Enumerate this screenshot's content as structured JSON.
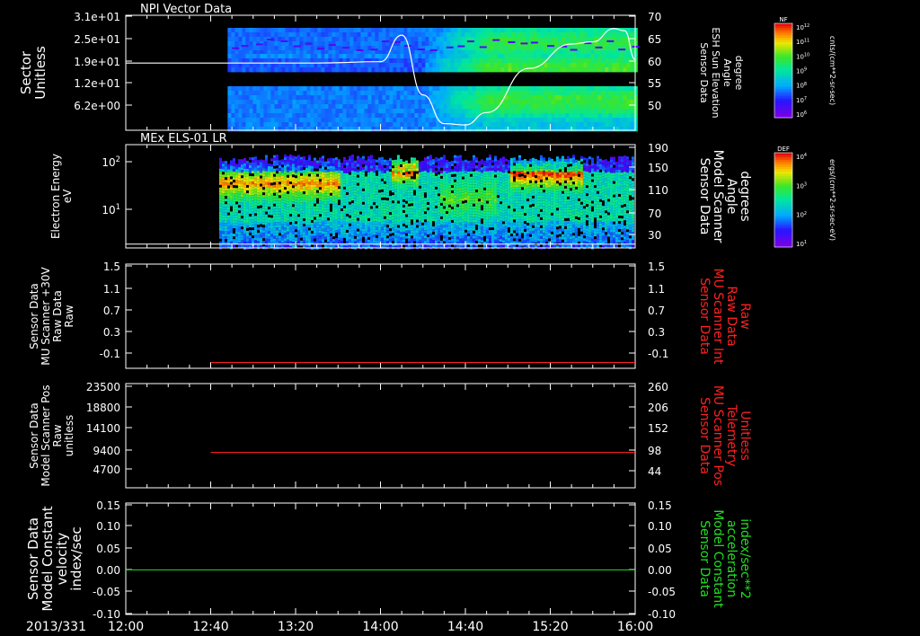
{
  "time_axis": {
    "date_label": "2013/331",
    "ticks": [
      "12:00",
      "12:40",
      "13:20",
      "14:00",
      "14:40",
      "15:20",
      "16:00"
    ]
  },
  "colorbars": [
    {
      "tag": "NF",
      "unit": "cnts/(cm**2-sr-sec)",
      "ticks": [
        "10^12",
        "10^11",
        "10^10",
        "10^9",
        "10^8",
        "10^7",
        "10^6"
      ]
    },
    {
      "tag": "DEF",
      "unit": "ergs/(cm**2-sr-sec-eV)",
      "ticks": [
        "10^4",
        "10^3",
        "10^2",
        "10^1"
      ]
    }
  ],
  "panels": [
    {
      "id": "npi",
      "title": "NPI Vector Data",
      "left_label": [
        "Sector",
        "Unitless"
      ],
      "left_ticks": [
        "3.1e+01",
        "2.5e+01",
        "1.9e+01",
        "1.2e+01",
        "6.2e+00"
      ],
      "right_label": [
        "Sensor Data",
        "ESH Sun Elevation",
        "Angle",
        "degree"
      ],
      "right_ticks": [
        "70",
        "65",
        "60",
        "55",
        "50"
      ],
      "right_color": "#ffffff"
    },
    {
      "id": "els",
      "title": "MEx ELS-01 LR",
      "left_label": [
        "Electron Energy",
        "eV"
      ],
      "left_ticks": [
        "10^2",
        "10^1"
      ],
      "right_label": [
        "Sensor Data",
        "Model Scanner",
        "Angle",
        "degrees"
      ],
      "right_ticks": [
        "190",
        "150",
        "110",
        "70",
        "30"
      ],
      "right_color": "#ffffff"
    },
    {
      "id": "mu_raw",
      "title": "",
      "left_label": [
        "Sensor Data",
        "MU Scanner +30V",
        "Raw Data",
        "Raw"
      ],
      "left_ticks": [
        "1.5",
        "1.1",
        "0.7",
        "0.3",
        "-0.1"
      ],
      "right_label": [
        "Sensor Data",
        "MU Scanner Int",
        "Raw Data",
        "Raw"
      ],
      "right_ticks": [
        "1.5",
        "1.1",
        "0.7",
        "0.3",
        "-0.1"
      ],
      "right_color": "#ff2020"
    },
    {
      "id": "scanner_pos",
      "title": "",
      "left_label": [
        "Sensor Data",
        "Model Scanner Pos",
        "Raw",
        "unitless"
      ],
      "left_ticks": [
        "23500",
        "18800",
        "14100",
        "9400",
        "4700"
      ],
      "right_label": [
        "Sensor Data",
        "MU Scanner Pos",
        "Telemetry",
        "Unitless"
      ],
      "right_ticks": [
        "260",
        "206",
        "152",
        "98",
        "44"
      ],
      "right_color": "#ff2020"
    },
    {
      "id": "constants",
      "title": "",
      "left_label": [
        "Sensor Data",
        "Model Constant",
        "velocity",
        "index/sec"
      ],
      "left_ticks": [
        "0.15",
        "0.10",
        "0.05",
        "0.00",
        "-0.05",
        "-0.10"
      ],
      "right_label": [
        "Sensor Data",
        "Model Constant",
        "acceleration",
        "index/sec**2"
      ],
      "right_ticks": [
        "0.15",
        "0.10",
        "0.05",
        "0.00",
        "-0.05",
        "-0.10"
      ],
      "right_color": "#22dd22"
    }
  ],
  "chart_data": [
    {
      "type": "heatmap",
      "title": "NPI Vector Data",
      "ylabel": "Sector Unitless",
      "x_range": [
        "12:00",
        "16:00"
      ],
      "data_start": "12:48",
      "y_range": [
        1,
        31
      ],
      "overlay_series": {
        "name": "Sensor Data ESH Sun Elevation Angle degree",
        "color": "#ffffff",
        "ylim": [
          44,
          70
        ],
        "x": [
          "12:00",
          "13:30",
          "14:00",
          "14:10",
          "14:20",
          "14:30",
          "14:40",
          "14:50",
          "15:10",
          "15:30",
          "15:40",
          "15:50",
          "15:55",
          "16:00"
        ],
        "y": [
          59.2,
          59.2,
          59.5,
          65.5,
          52,
          45.5,
          45.2,
          48,
          58,
          63.5,
          64,
          67,
          66.5,
          60
        ]
      }
    },
    {
      "type": "heatmap",
      "title": "MEx ELS-01 LR",
      "ylabel": "Electron Energy eV",
      "y_scale": "log",
      "x_range": [
        "12:00",
        "16:00"
      ],
      "data_start": "12:44",
      "colorbar": "DEF ergs/(cm**2-sr-sec-eV)",
      "overlay_series": {
        "name": "Sensor Data Model Scanner Angle degrees",
        "color": "#ffffff",
        "ylim": [
          0,
          190
        ],
        "x": [
          "12:00",
          "16:00"
        ],
        "y": [
          7,
          7
        ]
      }
    },
    {
      "type": "line",
      "x_range": [
        "12:00",
        "16:00"
      ],
      "ylim": [
        -0.3,
        1.5
      ],
      "series": [
        {
          "name": "Sensor Data MU Scanner +30V Raw Data Raw",
          "color": "#ff2020",
          "x": [
            "12:40",
            "16:00"
          ],
          "y": [
            -0.2,
            -0.2
          ]
        }
      ]
    },
    {
      "type": "line",
      "x_range": [
        "12:00",
        "16:00"
      ],
      "ylim": [
        0,
        23500
      ],
      "series": [
        {
          "name": "Sensor Data MU Scanner Pos Telemetry Unitless",
          "color": "#ff2020",
          "x": [
            "12:40",
            "16:00"
          ],
          "y": [
            8000,
            8000
          ]
        }
      ]
    },
    {
      "type": "line",
      "x_range": [
        "12:00",
        "16:00"
      ],
      "ylim": [
        -0.1,
        0.15
      ],
      "series": [
        {
          "name": "Sensor Data Model Constant velocity index/sec",
          "color": "#22dd22",
          "x": [
            "12:00",
            "16:00"
          ],
          "y": [
            0,
            0
          ]
        }
      ]
    }
  ]
}
